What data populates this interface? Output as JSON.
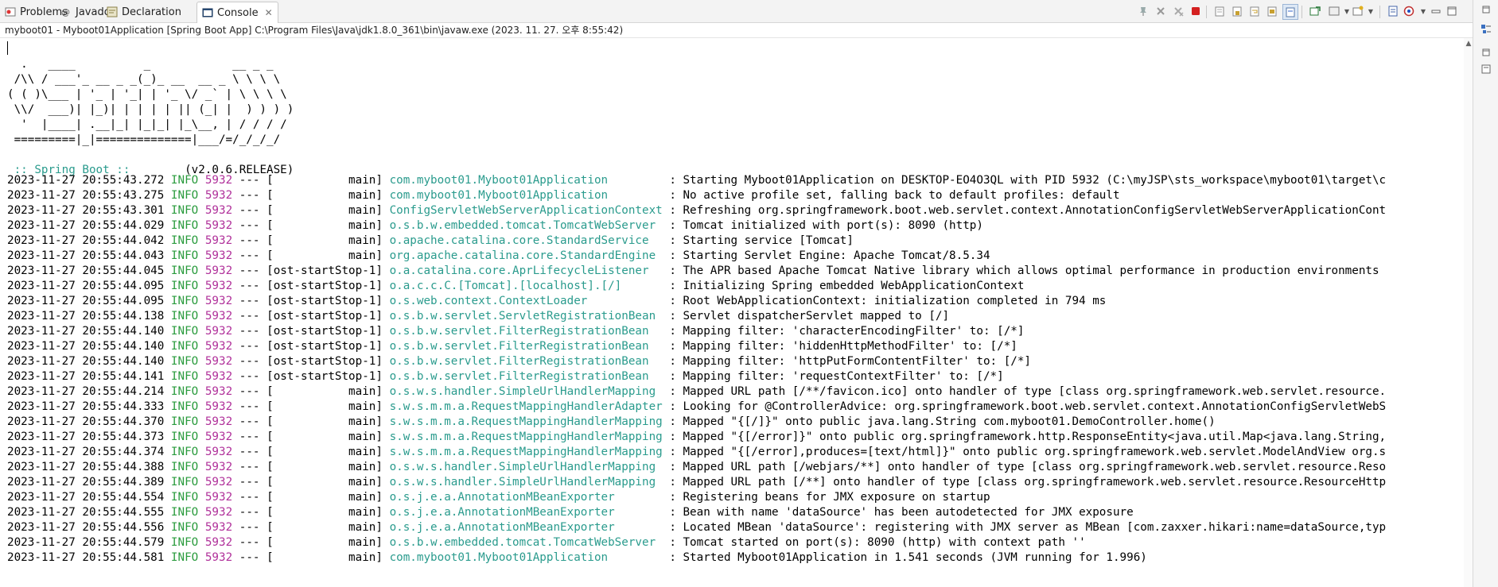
{
  "tabs": [
    {
      "label": "Problems",
      "icon": "problems-icon",
      "active": false
    },
    {
      "label": "Javadoc",
      "icon": "javadoc-icon",
      "active": false
    },
    {
      "label": "Declaration",
      "icon": "declaration-icon",
      "active": false
    },
    {
      "label": "Console",
      "icon": "console-icon",
      "active": true
    }
  ],
  "launch_info": "myboot01 - Myboot01Application [Spring Boot App] C:\\Program Files\\Java\\jdk1.8.0_361\\bin\\javaw.exe (2023. 11. 27. 오후 8:55:42)",
  "banner_art": [
    "  .   ____          _            __ _ _",
    " /\\\\ / ___'_ __ _ _(_)_ __  __ _ \\ \\ \\ \\",
    "( ( )\\___ | '_ | '_| | '_ \\/ _` | \\ \\ \\ \\",
    " \\\\/  ___)| |_)| | | | | || (_| |  ) ) ) )",
    "  '  |____| .__|_| |_|_| |_\\__, | / / / /",
    " =========|_|==============|___/=/_/_/_/"
  ],
  "banner_label": " :: Spring Boot :: ",
  "banner_version": "       (v2.0.6.RELEASE)",
  "log_lines": [
    {
      "date": "2023-11-27 20:55:43.272",
      "level": "INFO",
      "pid": "5932",
      "sep": "---",
      "thread": "[           main]",
      "logger": "com.myboot01.Myboot01Application        ",
      "msg": " : Starting Myboot01Application on DESKTOP-EO4O3QL with PID 5932 (C:\\myJSP\\sts_workspace\\myboot01\\target\\c"
    },
    {
      "date": "2023-11-27 20:55:43.275",
      "level": "INFO",
      "pid": "5932",
      "sep": "---",
      "thread": "[           main]",
      "logger": "com.myboot01.Myboot01Application        ",
      "msg": " : No active profile set, falling back to default profiles: default"
    },
    {
      "date": "2023-11-27 20:55:43.301",
      "level": "INFO",
      "pid": "5932",
      "sep": "---",
      "thread": "[           main]",
      "logger": "ConfigServletWebServerApplicationContext",
      "msg": " : Refreshing org.springframework.boot.web.servlet.context.AnnotationConfigServletWebServerApplicationCont"
    },
    {
      "date": "2023-11-27 20:55:44.029",
      "level": "INFO",
      "pid": "5932",
      "sep": "---",
      "thread": "[           main]",
      "logger": "o.s.b.w.embedded.tomcat.TomcatWebServer ",
      "msg": " : Tomcat initialized with port(s): 8090 (http)"
    },
    {
      "date": "2023-11-27 20:55:44.042",
      "level": "INFO",
      "pid": "5932",
      "sep": "---",
      "thread": "[           main]",
      "logger": "o.apache.catalina.core.StandardService  ",
      "msg": " : Starting service [Tomcat]"
    },
    {
      "date": "2023-11-27 20:55:44.043",
      "level": "INFO",
      "pid": "5932",
      "sep": "---",
      "thread": "[           main]",
      "logger": "org.apache.catalina.core.StandardEngine ",
      "msg": " : Starting Servlet Engine: Apache Tomcat/8.5.34"
    },
    {
      "date": "2023-11-27 20:55:44.045",
      "level": "INFO",
      "pid": "5932",
      "sep": "---",
      "thread": "[ost-startStop-1]",
      "logger": "o.a.catalina.core.AprLifecycleListener  ",
      "msg": " : The APR based Apache Tomcat Native library which allows optimal performance in production environments"
    },
    {
      "date": "2023-11-27 20:55:44.095",
      "level": "INFO",
      "pid": "5932",
      "sep": "---",
      "thread": "[ost-startStop-1]",
      "logger": "o.a.c.c.C.[Tomcat].[localhost].[/]      ",
      "msg": " : Initializing Spring embedded WebApplicationContext"
    },
    {
      "date": "2023-11-27 20:55:44.095",
      "level": "INFO",
      "pid": "5932",
      "sep": "---",
      "thread": "[ost-startStop-1]",
      "logger": "o.s.web.context.ContextLoader           ",
      "msg": " : Root WebApplicationContext: initialization completed in 794 ms"
    },
    {
      "date": "2023-11-27 20:55:44.138",
      "level": "INFO",
      "pid": "5932",
      "sep": "---",
      "thread": "[ost-startStop-1]",
      "logger": "o.s.b.w.servlet.ServletRegistrationBean ",
      "msg": " : Servlet dispatcherServlet mapped to [/]"
    },
    {
      "date": "2023-11-27 20:55:44.140",
      "level": "INFO",
      "pid": "5932",
      "sep": "---",
      "thread": "[ost-startStop-1]",
      "logger": "o.s.b.w.servlet.FilterRegistrationBean  ",
      "msg": " : Mapping filter: 'characterEncodingFilter' to: [/*]"
    },
    {
      "date": "2023-11-27 20:55:44.140",
      "level": "INFO",
      "pid": "5932",
      "sep": "---",
      "thread": "[ost-startStop-1]",
      "logger": "o.s.b.w.servlet.FilterRegistrationBean  ",
      "msg": " : Mapping filter: 'hiddenHttpMethodFilter' to: [/*]"
    },
    {
      "date": "2023-11-27 20:55:44.140",
      "level": "INFO",
      "pid": "5932",
      "sep": "---",
      "thread": "[ost-startStop-1]",
      "logger": "o.s.b.w.servlet.FilterRegistrationBean  ",
      "msg": " : Mapping filter: 'httpPutFormContentFilter' to: [/*]"
    },
    {
      "date": "2023-11-27 20:55:44.141",
      "level": "INFO",
      "pid": "5932",
      "sep": "---",
      "thread": "[ost-startStop-1]",
      "logger": "o.s.b.w.servlet.FilterRegistrationBean  ",
      "msg": " : Mapping filter: 'requestContextFilter' to: [/*]"
    },
    {
      "date": "2023-11-27 20:55:44.214",
      "level": "INFO",
      "pid": "5932",
      "sep": "---",
      "thread": "[           main]",
      "logger": "o.s.w.s.handler.SimpleUrlHandlerMapping ",
      "msg": " : Mapped URL path [/**/favicon.ico] onto handler of type [class org.springframework.web.servlet.resource."
    },
    {
      "date": "2023-11-27 20:55:44.333",
      "level": "INFO",
      "pid": "5932",
      "sep": "---",
      "thread": "[           main]",
      "logger": "s.w.s.m.m.a.RequestMappingHandlerAdapter",
      "msg": " : Looking for @ControllerAdvice: org.springframework.boot.web.servlet.context.AnnotationConfigServletWebS"
    },
    {
      "date": "2023-11-27 20:55:44.370",
      "level": "INFO",
      "pid": "5932",
      "sep": "---",
      "thread": "[           main]",
      "logger": "s.w.s.m.m.a.RequestMappingHandlerMapping",
      "msg": " : Mapped \"{[/]}\" onto public java.lang.String com.myboot01.DemoController.home()"
    },
    {
      "date": "2023-11-27 20:55:44.373",
      "level": "INFO",
      "pid": "5932",
      "sep": "---",
      "thread": "[           main]",
      "logger": "s.w.s.m.m.a.RequestMappingHandlerMapping",
      "msg": " : Mapped \"{[/error]}\" onto public org.springframework.http.ResponseEntity<java.util.Map<java.lang.String,"
    },
    {
      "date": "2023-11-27 20:55:44.374",
      "level": "INFO",
      "pid": "5932",
      "sep": "---",
      "thread": "[           main]",
      "logger": "s.w.s.m.m.a.RequestMappingHandlerMapping",
      "msg": " : Mapped \"{[/error],produces=[text/html]}\" onto public org.springframework.web.servlet.ModelAndView org.s"
    },
    {
      "date": "2023-11-27 20:55:44.388",
      "level": "INFO",
      "pid": "5932",
      "sep": "---",
      "thread": "[           main]",
      "logger": "o.s.w.s.handler.SimpleUrlHandlerMapping ",
      "msg": " : Mapped URL path [/webjars/**] onto handler of type [class org.springframework.web.servlet.resource.Reso"
    },
    {
      "date": "2023-11-27 20:55:44.389",
      "level": "INFO",
      "pid": "5932",
      "sep": "---",
      "thread": "[           main]",
      "logger": "o.s.w.s.handler.SimpleUrlHandlerMapping ",
      "msg": " : Mapped URL path [/**] onto handler of type [class org.springframework.web.servlet.resource.ResourceHttp"
    },
    {
      "date": "2023-11-27 20:55:44.554",
      "level": "INFO",
      "pid": "5932",
      "sep": "---",
      "thread": "[           main]",
      "logger": "o.s.j.e.a.AnnotationMBeanExporter       ",
      "msg": " : Registering beans for JMX exposure on startup"
    },
    {
      "date": "2023-11-27 20:55:44.555",
      "level": "INFO",
      "pid": "5932",
      "sep": "---",
      "thread": "[           main]",
      "logger": "o.s.j.e.a.AnnotationMBeanExporter       ",
      "msg": " : Bean with name 'dataSource' has been autodetected for JMX exposure"
    },
    {
      "date": "2023-11-27 20:55:44.556",
      "level": "INFO",
      "pid": "5932",
      "sep": "---",
      "thread": "[           main]",
      "logger": "o.s.j.e.a.AnnotationMBeanExporter       ",
      "msg": " : Located MBean 'dataSource': registering with JMX server as MBean [com.zaxxer.hikari:name=dataSource,typ"
    },
    {
      "date": "2023-11-27 20:55:44.579",
      "level": "INFO",
      "pid": "5932",
      "sep": "---",
      "thread": "[           main]",
      "logger": "o.s.b.w.embedded.tomcat.TomcatWebServer ",
      "msg": " : Tomcat started on port(s): 8090 (http) with context path ''"
    },
    {
      "date": "2023-11-27 20:55:44.581",
      "level": "INFO",
      "pid": "5932",
      "sep": "---",
      "thread": "[           main]",
      "logger": "com.myboot01.Myboot01Application        ",
      "msg": " : Started Myboot01Application in 1.541 seconds (JVM running for 1.996)"
    }
  ],
  "toolbar_icons": [
    "pin-console-icon",
    "terminate-all-icon",
    "remove-all-terminated-icon",
    "terminate-icon",
    "clear-console-icon",
    "scroll-lock-icon",
    "word-wrap-icon",
    "show-on-stdout-icon",
    "show-on-stderr-icon",
    "display-selected-console-icon",
    "open-console-icon",
    "new-console-view-icon",
    "minimize-icon",
    "maximize-icon"
  ],
  "colors": {
    "level": "#2a9b3d",
    "pid": "#b0309a",
    "logger": "#2a9b8d",
    "terminate": "#d42020"
  }
}
